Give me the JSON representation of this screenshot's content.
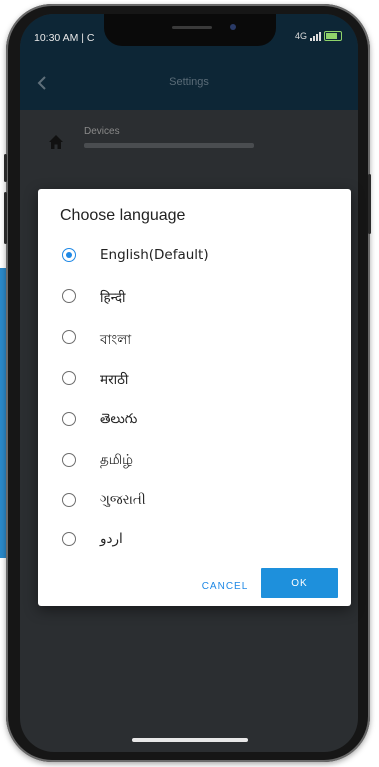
{
  "status_bar": {
    "time": "10:30 AM | C",
    "network": "4G"
  },
  "app_bar": {
    "title": "Settings"
  },
  "settings_list": {
    "devices_title": "Devices"
  },
  "dialog": {
    "title": "Choose language",
    "selected_index": 0,
    "options": [
      {
        "label": "English(Default)"
      },
      {
        "label": "हिन्दी"
      },
      {
        "label": "বাংলা"
      },
      {
        "label": "मराठी"
      },
      {
        "label": "తెలుగు"
      },
      {
        "label": "தமிழ்"
      },
      {
        "label": "ગુજરાતી"
      },
      {
        "label": "اردو"
      }
    ],
    "cancel_label": "CANCEL",
    "ok_label": "OK"
  },
  "colors": {
    "accent": "#1e88e5",
    "ok_button": "#1e90dc",
    "app_bar": "#0d2636",
    "side_accent": "#2b89c9"
  },
  "icons": {
    "back": "back-arrow-icon",
    "home": "home-icon",
    "signal": "signal-icon",
    "battery": "battery-icon"
  }
}
